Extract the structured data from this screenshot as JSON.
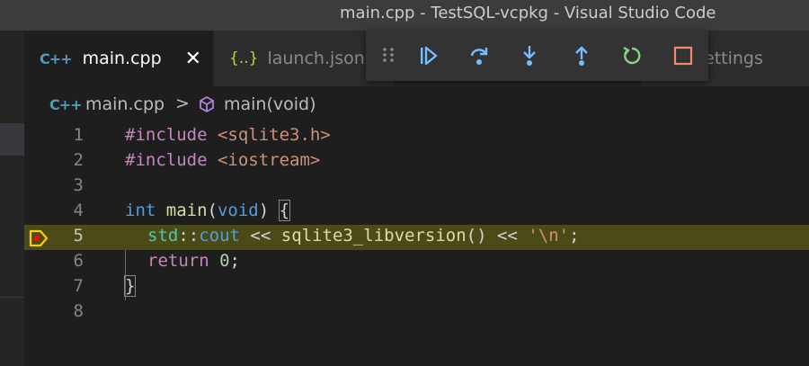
{
  "window": {
    "title": "main.cpp - TestSQL-vcpkg - Visual Studio Code"
  },
  "tabs": [
    {
      "icon": "C++",
      "label": "main.cpp",
      "close": "✕"
    },
    {
      "icon": "{..}",
      "label": "launch.json"
    },
    {
      "label": "ettings"
    }
  ],
  "debug_toolbar": {
    "buttons": [
      "continue",
      "step-over",
      "step-into",
      "step-out",
      "restart",
      "stop"
    ],
    "colors": {
      "action": "#75beff",
      "restart": "#89d185",
      "stop": "#f48771"
    }
  },
  "breadcrumb": {
    "icon": "C++",
    "file": "main.cpp",
    "separator": ">",
    "symbol": "main(void)"
  },
  "editor": {
    "current_line": 5,
    "lines": [
      {
        "n": "1"
      },
      {
        "n": "2"
      },
      {
        "n": "3"
      },
      {
        "n": "4"
      },
      {
        "n": "5"
      },
      {
        "n": "6"
      },
      {
        "n": "7"
      },
      {
        "n": "8"
      }
    ],
    "tokens": {
      "l1_kw": "#include ",
      "l1_str": "<sqlite3.h>",
      "l2_kw": "#include ",
      "l2_str": "<iostream>",
      "l4_type": "int",
      "l4_fn": " main",
      "l4_p1": "(",
      "l4_type2": "void",
      "l4_p2": ") ",
      "l4_brace": "{",
      "l5_ns": "std",
      "l5_op1": "::",
      "l5_var": "cout",
      "l5_op2": " << ",
      "l5_fn": "sqlite3_libversion",
      "l5_p": "() ",
      "l5_op3": "<< ",
      "l5_str": "'\\n'",
      "l5_end": ";",
      "l6_kw": "return ",
      "l6_num": "0",
      "l6_end": ";",
      "l7_brace": "}"
    }
  }
}
